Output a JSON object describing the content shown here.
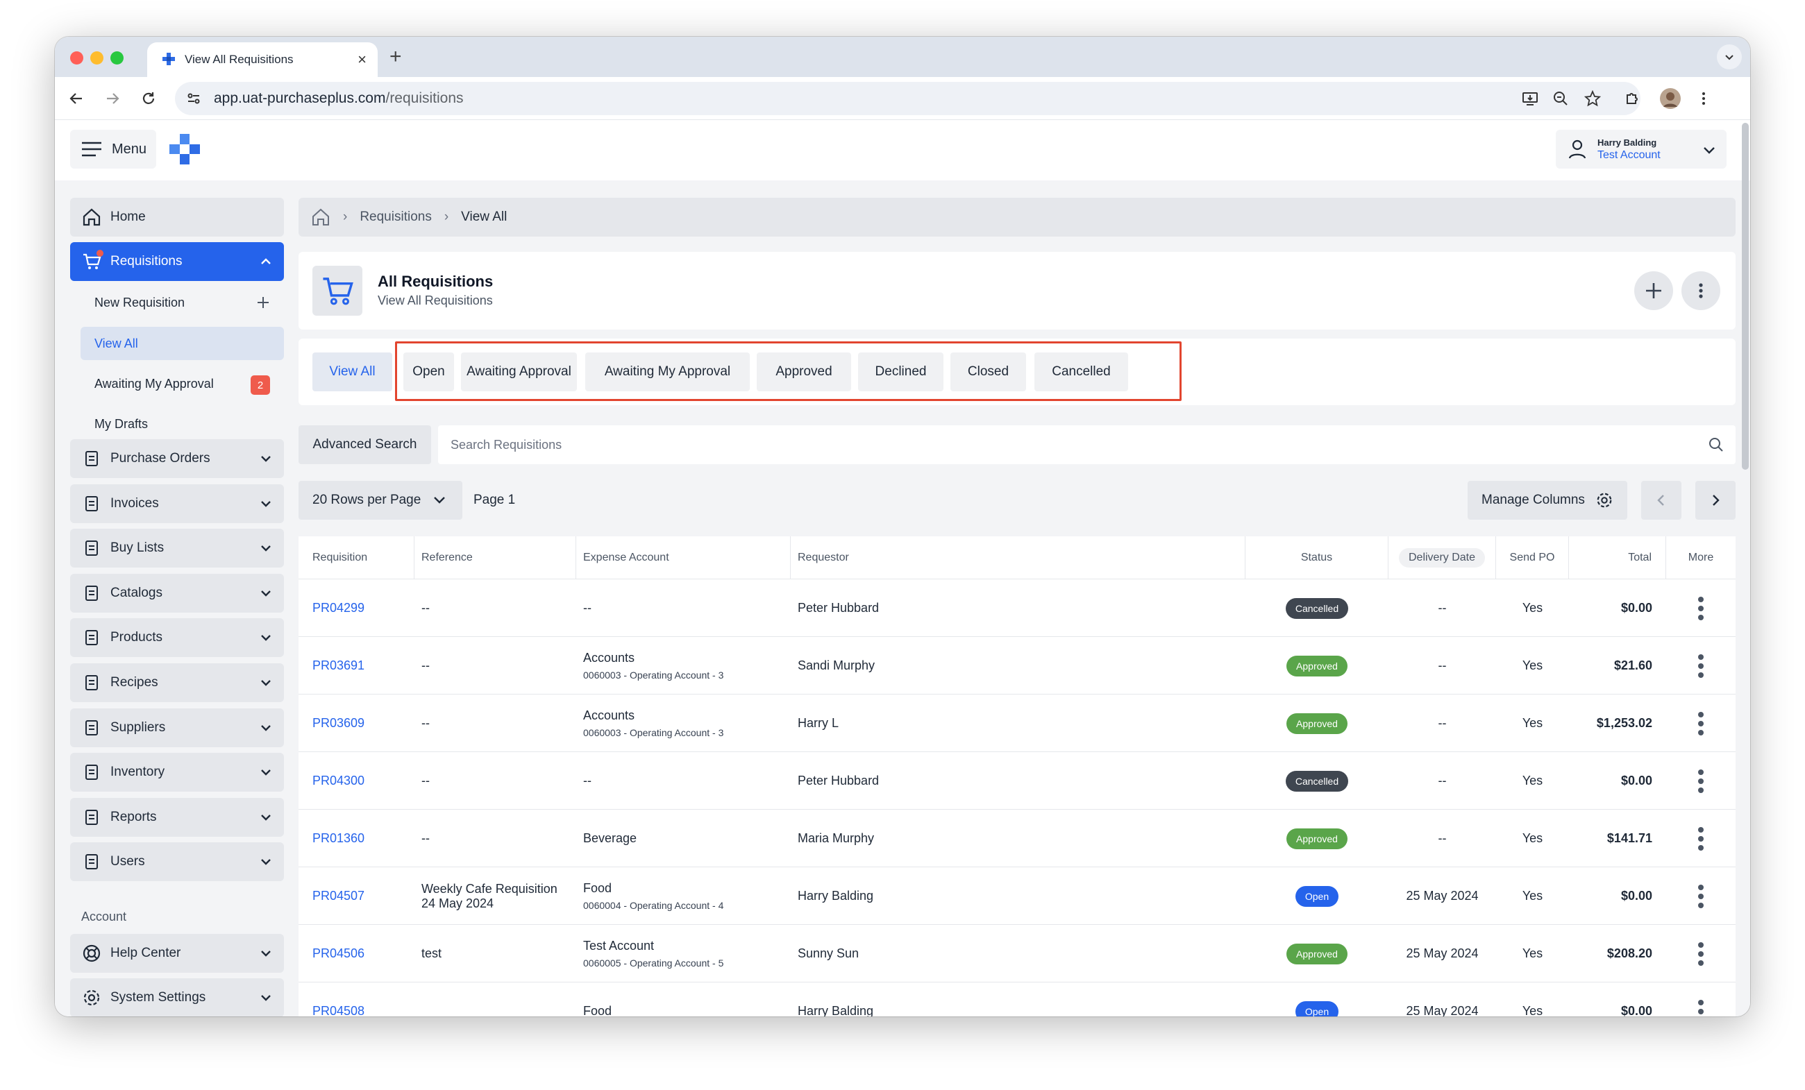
{
  "browser": {
    "tab_title": "View All Requisitions",
    "url_host": "app.uat-purchaseplus.com",
    "url_path": "/requisitions"
  },
  "topbar": {
    "menu_label": "Menu",
    "user_name": "Harry Balding",
    "account_name": "Test Account"
  },
  "sidebar": {
    "home": "Home",
    "requisitions": "Requisitions",
    "sub": {
      "new": "New Requisition",
      "view_all": "View All",
      "awaiting_my_approval": "Awaiting My Approval",
      "awaiting_count": "2",
      "drafts": "My Drafts"
    },
    "items": [
      "Purchase Orders",
      "Invoices",
      "Buy Lists",
      "Catalogs",
      "Products",
      "Recipes",
      "Suppliers",
      "Inventory",
      "Reports",
      "Users"
    ],
    "account_label": "Account",
    "help": "Help Center",
    "settings": "System Settings"
  },
  "breadcrumb": {
    "section": "Requisitions",
    "current": "View All"
  },
  "header": {
    "title": "All Requisitions",
    "subtitle": "View All Requisitions"
  },
  "filters": [
    "View All",
    "Open",
    "Awaiting Approval",
    "Awaiting My Approval",
    "Approved",
    "Declined",
    "Closed",
    "Cancelled"
  ],
  "search": {
    "advanced": "Advanced Search",
    "placeholder": "Search Requisitions"
  },
  "pagination": {
    "rows_per_page": "20 Rows per Page",
    "page": "Page 1",
    "manage_columns": "Manage Columns"
  },
  "table": {
    "columns": [
      "Requisition",
      "Reference",
      "Expense Account",
      "Requestor",
      "Status",
      "Delivery Date",
      "Send PO",
      "Total",
      "More"
    ],
    "rows": [
      {
        "id": "PR04299",
        "ref": "--",
        "ref2": "",
        "exp": "--",
        "exp2": "",
        "requestor": "Peter Hubbard",
        "status": "Cancelled",
        "date": "--",
        "send": "Yes",
        "total": "$0.00"
      },
      {
        "id": "PR03691",
        "ref": "--",
        "ref2": "",
        "exp": "Accounts",
        "exp2": "0060003 - Operating Account - 3",
        "requestor": "Sandi Murphy",
        "status": "Approved",
        "date": "--",
        "send": "Yes",
        "total": "$21.60"
      },
      {
        "id": "PR03609",
        "ref": "--",
        "ref2": "",
        "exp": "Accounts",
        "exp2": "0060003 - Operating Account - 3",
        "requestor": "Harry L",
        "status": "Approved",
        "date": "--",
        "send": "Yes",
        "total": "$1,253.02"
      },
      {
        "id": "PR04300",
        "ref": "--",
        "ref2": "",
        "exp": "--",
        "exp2": "",
        "requestor": "Peter Hubbard",
        "status": "Cancelled",
        "date": "--",
        "send": "Yes",
        "total": "$0.00"
      },
      {
        "id": "PR01360",
        "ref": "--",
        "ref2": "",
        "exp": "Beverage",
        "exp2": "",
        "requestor": "Maria Murphy",
        "status": "Approved",
        "date": "--",
        "send": "Yes",
        "total": "$141.71"
      },
      {
        "id": "PR04507",
        "ref": "Weekly Cafe Requisition",
        "ref2": "24 May 2024",
        "exp": "Food",
        "exp2": "0060004 - Operating Account - 4",
        "requestor": "Harry Balding",
        "status": "Open",
        "date": "25 May 2024",
        "send": "Yes",
        "total": "$0.00"
      },
      {
        "id": "PR04506",
        "ref": "test",
        "ref2": "",
        "exp": "Test Account",
        "exp2": "0060005 - Operating Account - 5",
        "requestor": "Sunny Sun",
        "status": "Approved",
        "date": "25 May 2024",
        "send": "Yes",
        "total": "$208.20"
      },
      {
        "id": "PR04508",
        "ref": "",
        "ref2": "",
        "exp": "Food",
        "exp2": "",
        "requestor": "Harry Balding",
        "status": "Open",
        "date": "25 May 2024",
        "send": "Yes",
        "total": "$0.00"
      }
    ]
  },
  "colors": {
    "accent": "#2563eb",
    "approved": "#5aa54a",
    "cancelled": "#3f4650",
    "badge": "#ef5b4c",
    "highlight": "#e2452f"
  }
}
